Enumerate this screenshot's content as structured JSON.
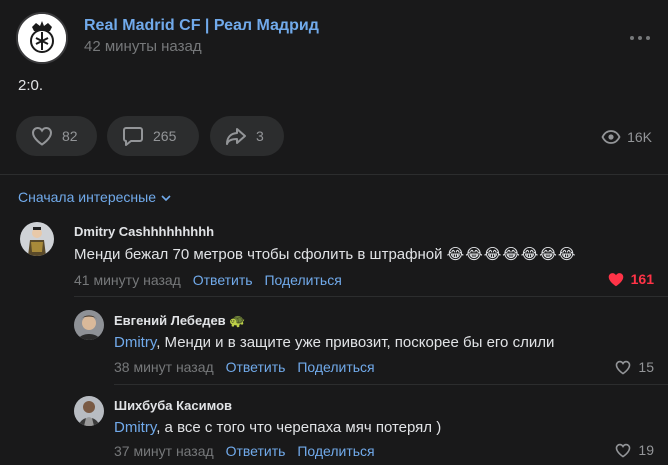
{
  "post": {
    "author": "Real Madrid CF | Реал Мадрид",
    "time": "42 минуты назад",
    "text": "2:0.",
    "avatar_icon": "real-madrid-crest-icon",
    "more_icon": "more-horizontal-icon"
  },
  "actions": {
    "likes": "82",
    "comments": "265",
    "shares": "3",
    "views": "16K"
  },
  "sort": {
    "label": "Сначала интересные"
  },
  "comments": [
    {
      "author": "Dmitry Cashhhhhhhhh",
      "text": "Менди бежал 70 метров чтобы сфолить в штрафной",
      "emoji": "😂😂😂😂😂😂😂",
      "time": "41 минуту назад",
      "reply": "Ответить",
      "share": "Поделиться",
      "likes": "161",
      "liked": true
    },
    {
      "author": "Евгений Лебедев",
      "author_badge": "🐢",
      "mention": "Dmitry",
      "text": ", Менди и в защите уже привозит, поскорее бы его слили",
      "time": "38 минут назад",
      "reply": "Ответить",
      "share": "Поделиться",
      "likes": "15",
      "liked": false
    },
    {
      "author": "Шихбуба Касимов",
      "mention": "Dmitry",
      "text": ", а все с того что черепаха мяч потерял )",
      "time": "37 минут назад",
      "reply": "Ответить",
      "share": "Поделиться",
      "likes": "19",
      "liked": false
    }
  ],
  "colors": {
    "background": "#19191a",
    "accent": "#71aaeb",
    "like_active": "#ff3347",
    "muted": "#76787a"
  }
}
